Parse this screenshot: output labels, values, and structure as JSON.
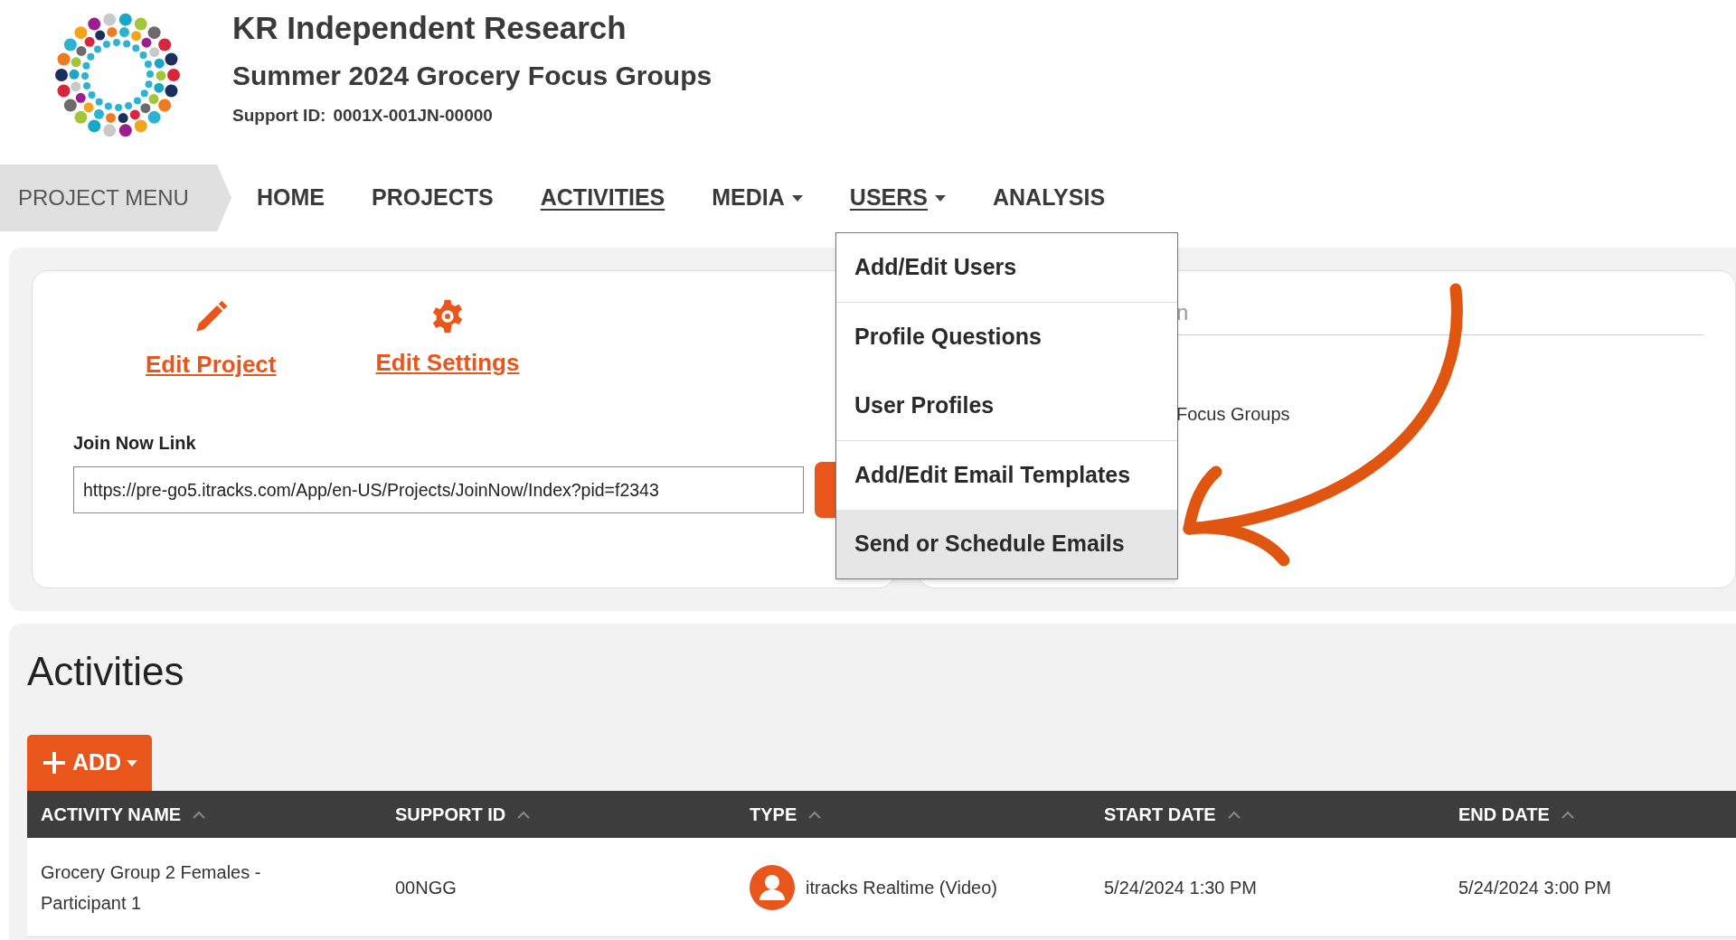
{
  "header": {
    "company": "KR Independent Research",
    "project": "Summer 2024 Grocery Focus Groups",
    "support_label": "Support ID:",
    "support_id": "0001X-001JN-00000"
  },
  "nav": {
    "project_menu": "PROJECT MENU",
    "items": [
      {
        "label": "HOME",
        "kind": "link",
        "selected": false
      },
      {
        "label": "PROJECTS",
        "kind": "link",
        "selected": false
      },
      {
        "label": "ACTIVITIES",
        "kind": "link",
        "selected": true
      },
      {
        "label": "MEDIA",
        "kind": "menu",
        "expanded": false
      },
      {
        "label": "USERS",
        "kind": "menu",
        "expanded": true
      },
      {
        "label": "ANALYSIS",
        "kind": "link",
        "selected": false
      }
    ]
  },
  "users_menu": {
    "groups": [
      [
        {
          "label": "Add/Edit Users",
          "selected": false
        }
      ],
      [
        {
          "label": "Profile Questions",
          "selected": false
        },
        {
          "label": "User Profiles",
          "selected": false
        }
      ],
      [
        {
          "label": "Add/Edit Email Templates",
          "selected": false
        },
        {
          "label": "Send or Schedule Emails",
          "selected": true
        }
      ]
    ]
  },
  "project_card": {
    "actions": [
      {
        "label": "Edit Project",
        "kind": "pencil"
      },
      {
        "label": "Edit Settings",
        "kind": "gear"
      }
    ],
    "join_label": "Join Now Link",
    "join_value": "https://pre-go5.itracks.com/App/en-US/Projects/JoinNow/Index?pid=f2343"
  },
  "info_card": {
    "heading_fragment": "n",
    "text_fragment": "Focus Groups"
  },
  "activities": {
    "title": "Activities",
    "add_button": "ADD",
    "columns": [
      "ACTIVITY NAME",
      "SUPPORT ID",
      "TYPE",
      "START DATE",
      "END DATE"
    ],
    "rows": [
      {
        "name": "Grocery Group 2 Females - Participant 1",
        "support_id": "00NGG",
        "type": "itracks Realtime (Video)",
        "start": "5/24/2024 1:30 PM",
        "end": "5/24/2024 3:00 PM"
      }
    ]
  }
}
